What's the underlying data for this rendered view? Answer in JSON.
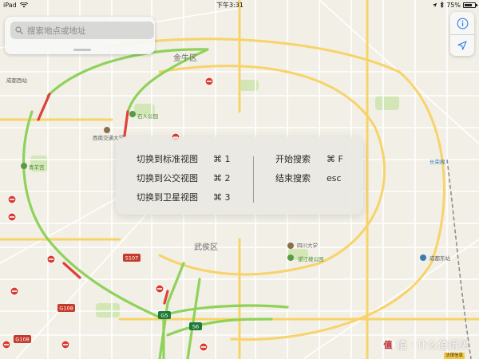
{
  "status_bar": {
    "device": "iPad",
    "time": "下午3:31",
    "battery": "75%",
    "battery_level": 0.75
  },
  "search": {
    "placeholder": "搜索地点或地址"
  },
  "shortcuts": {
    "left": [
      {
        "label": "切换到标准视图",
        "key": "⌘ 1"
      },
      {
        "label": "切换到公交视图",
        "key": "⌘ 2"
      },
      {
        "label": "切换到卫星视图",
        "key": "⌘ 3"
      }
    ],
    "right": [
      {
        "label": "开始搜索",
        "key": "⌘ F"
      },
      {
        "label": "结束搜索",
        "key": "esc"
      }
    ]
  },
  "map": {
    "districts": [
      "金牛区",
      "武侯区"
    ],
    "pois": [
      {
        "name": "成都西站"
      },
      {
        "name": "西南交通大学"
      },
      {
        "name": "石人公园"
      },
      {
        "name": "四川大学"
      },
      {
        "name": "望江楼公园"
      },
      {
        "name": "成都东站"
      },
      {
        "name": "青羊宫"
      },
      {
        "name": "长荣阁"
      }
    ],
    "route_shields": [
      "S107",
      "G5",
      "S6",
      "G108",
      "G108"
    ]
  },
  "watermark": {
    "text": "值 · 什么值得买",
    "logo": "值"
  },
  "legal": {
    "text": "法律信息"
  },
  "colors": {
    "highway": "#8ed25a",
    "arterial": "#f7d36a",
    "congested": "#e0403a",
    "park": "#cfe5b0",
    "water": "#9fd0e8"
  }
}
